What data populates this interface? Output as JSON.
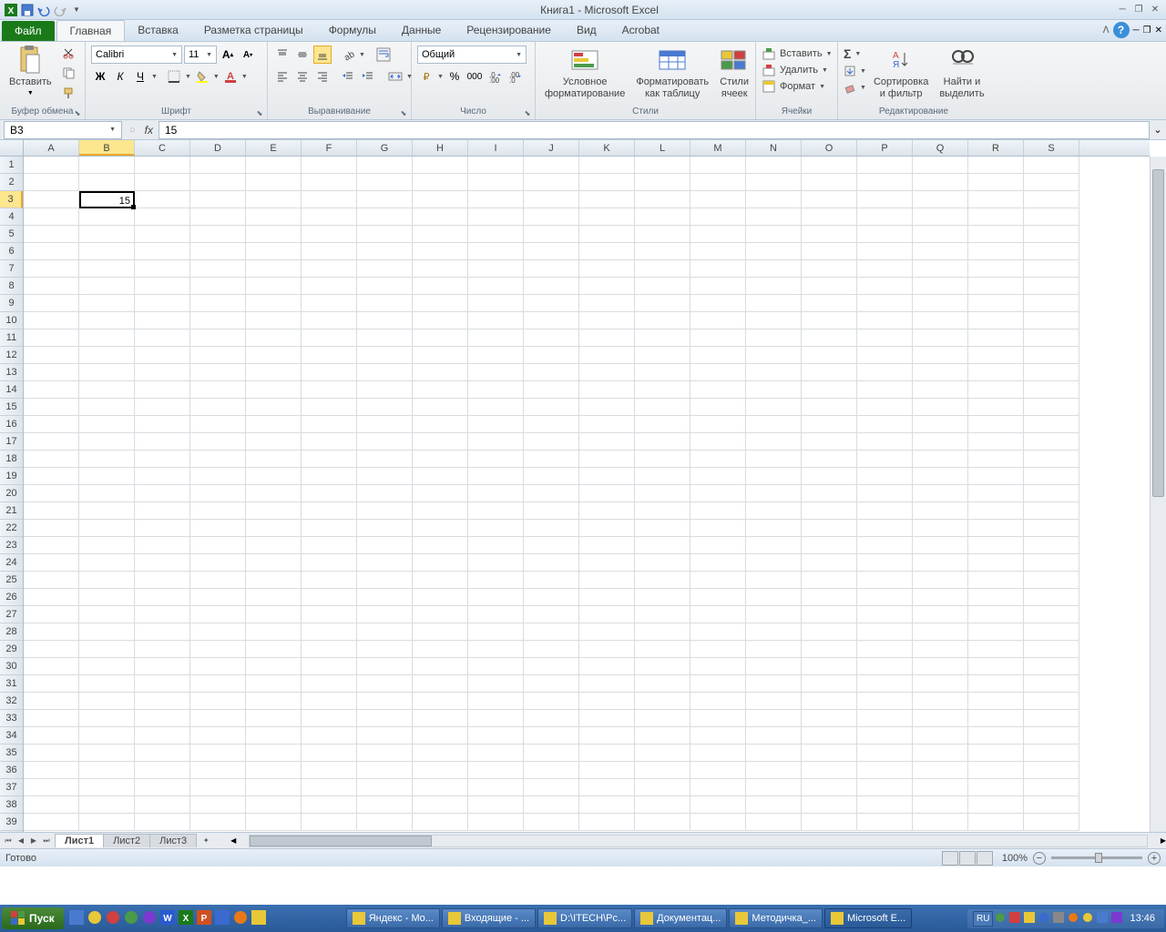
{
  "title": "Книга1 - Microsoft Excel",
  "tabs": {
    "file": "Файл",
    "list": [
      "Главная",
      "Вставка",
      "Разметка страницы",
      "Формулы",
      "Данные",
      "Рецензирование",
      "Вид",
      "Acrobat"
    ],
    "active": 0
  },
  "ribbon": {
    "clipboard": {
      "label": "Буфер обмена",
      "paste": "Вставить"
    },
    "font": {
      "label": "Шрифт",
      "name": "Calibri",
      "size": "11"
    },
    "alignment": {
      "label": "Выравнивание"
    },
    "number": {
      "label": "Число",
      "format": "Общий"
    },
    "styles": {
      "label": "Стили",
      "conditional": "Условное\nформатирование",
      "table": "Форматировать\nкак таблицу",
      "cell": "Стили\nячеек"
    },
    "cells": {
      "label": "Ячейки",
      "insert": "Вставить",
      "delete": "Удалить",
      "format": "Формат"
    },
    "editing": {
      "label": "Редактирование",
      "sort": "Сортировка\nи фильтр",
      "find": "Найти и\nвыделить"
    }
  },
  "namebox": "B3",
  "formula": "15",
  "columns": [
    "A",
    "B",
    "C",
    "D",
    "E",
    "F",
    "G",
    "H",
    "I",
    "J",
    "K",
    "L",
    "M",
    "N",
    "O",
    "P",
    "Q",
    "R",
    "S"
  ],
  "activeCol": 1,
  "rows": 39,
  "activeRow": 3,
  "cellData": {
    "B3": "15"
  },
  "sheets": {
    "list": [
      "Лист1",
      "Лист2",
      "Лист3"
    ],
    "active": 0
  },
  "status": "Готово",
  "zoom": "100%",
  "taskbar": {
    "start": "Пуск",
    "items": [
      "Яндекс - Mo...",
      "Входящие - ...",
      "D:\\ITECH\\Рс...",
      "Документац...",
      "Методичка_...",
      "Microsoft E..."
    ],
    "activeItem": 5,
    "lang": "RU",
    "clock": "13:46"
  }
}
